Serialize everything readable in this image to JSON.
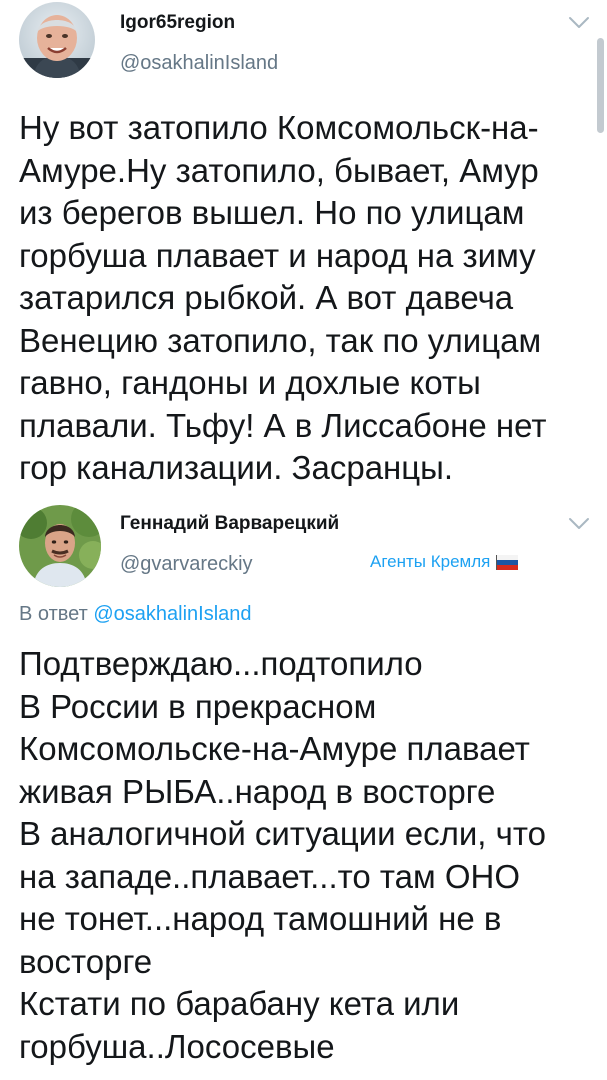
{
  "tweets": [
    {
      "author": {
        "display_name": "Igor65region",
        "handle": "@osakhalinIsland"
      },
      "text_lines": [
        "Ну вот затопило Комсомольск-на-",
        "Амуре.Ну затопило, бывает, Амур",
        "из берегов вышел. Но по улицам",
        "горбуша плавает и народ на зиму",
        "затарился рыбкой. А вот давеча",
        "Венецию затопило, так по улицам",
        "гавно, гандоны и дохлые коты",
        "плавали. Тьфу! А в Лиссабоне нет",
        "гор канализации. Засранцы."
      ],
      "menu_icon": "chevron-down-icon"
    },
    {
      "author": {
        "display_name": "Геннадий Варварецкий",
        "handle": "@gvarvareckiy"
      },
      "list_label": "Агенты Кремля",
      "list_label_icon": "russian-flag-icon",
      "reply_to": {
        "prefix": "В ответ",
        "mention": "@osakhalinIsland"
      },
      "text_lines": [
        "Подтверждаю...подтопило",
        "В России в прекрасном",
        "Комсомольске-на-Амуре плавает",
        "живая РЫБА..народ в восторге",
        "В аналогичной ситуации если, что",
        "на западе..плавает...то там ОНО",
        "не тонет...народ тамошний не в",
        "восторге",
        "Кстати по барабану кета или",
        "горбуша..Лососевые"
      ],
      "menu_icon": "chevron-down-icon"
    }
  ],
  "colors": {
    "text": "#14171a",
    "secondary": "#657786",
    "link": "#1da1f2"
  }
}
